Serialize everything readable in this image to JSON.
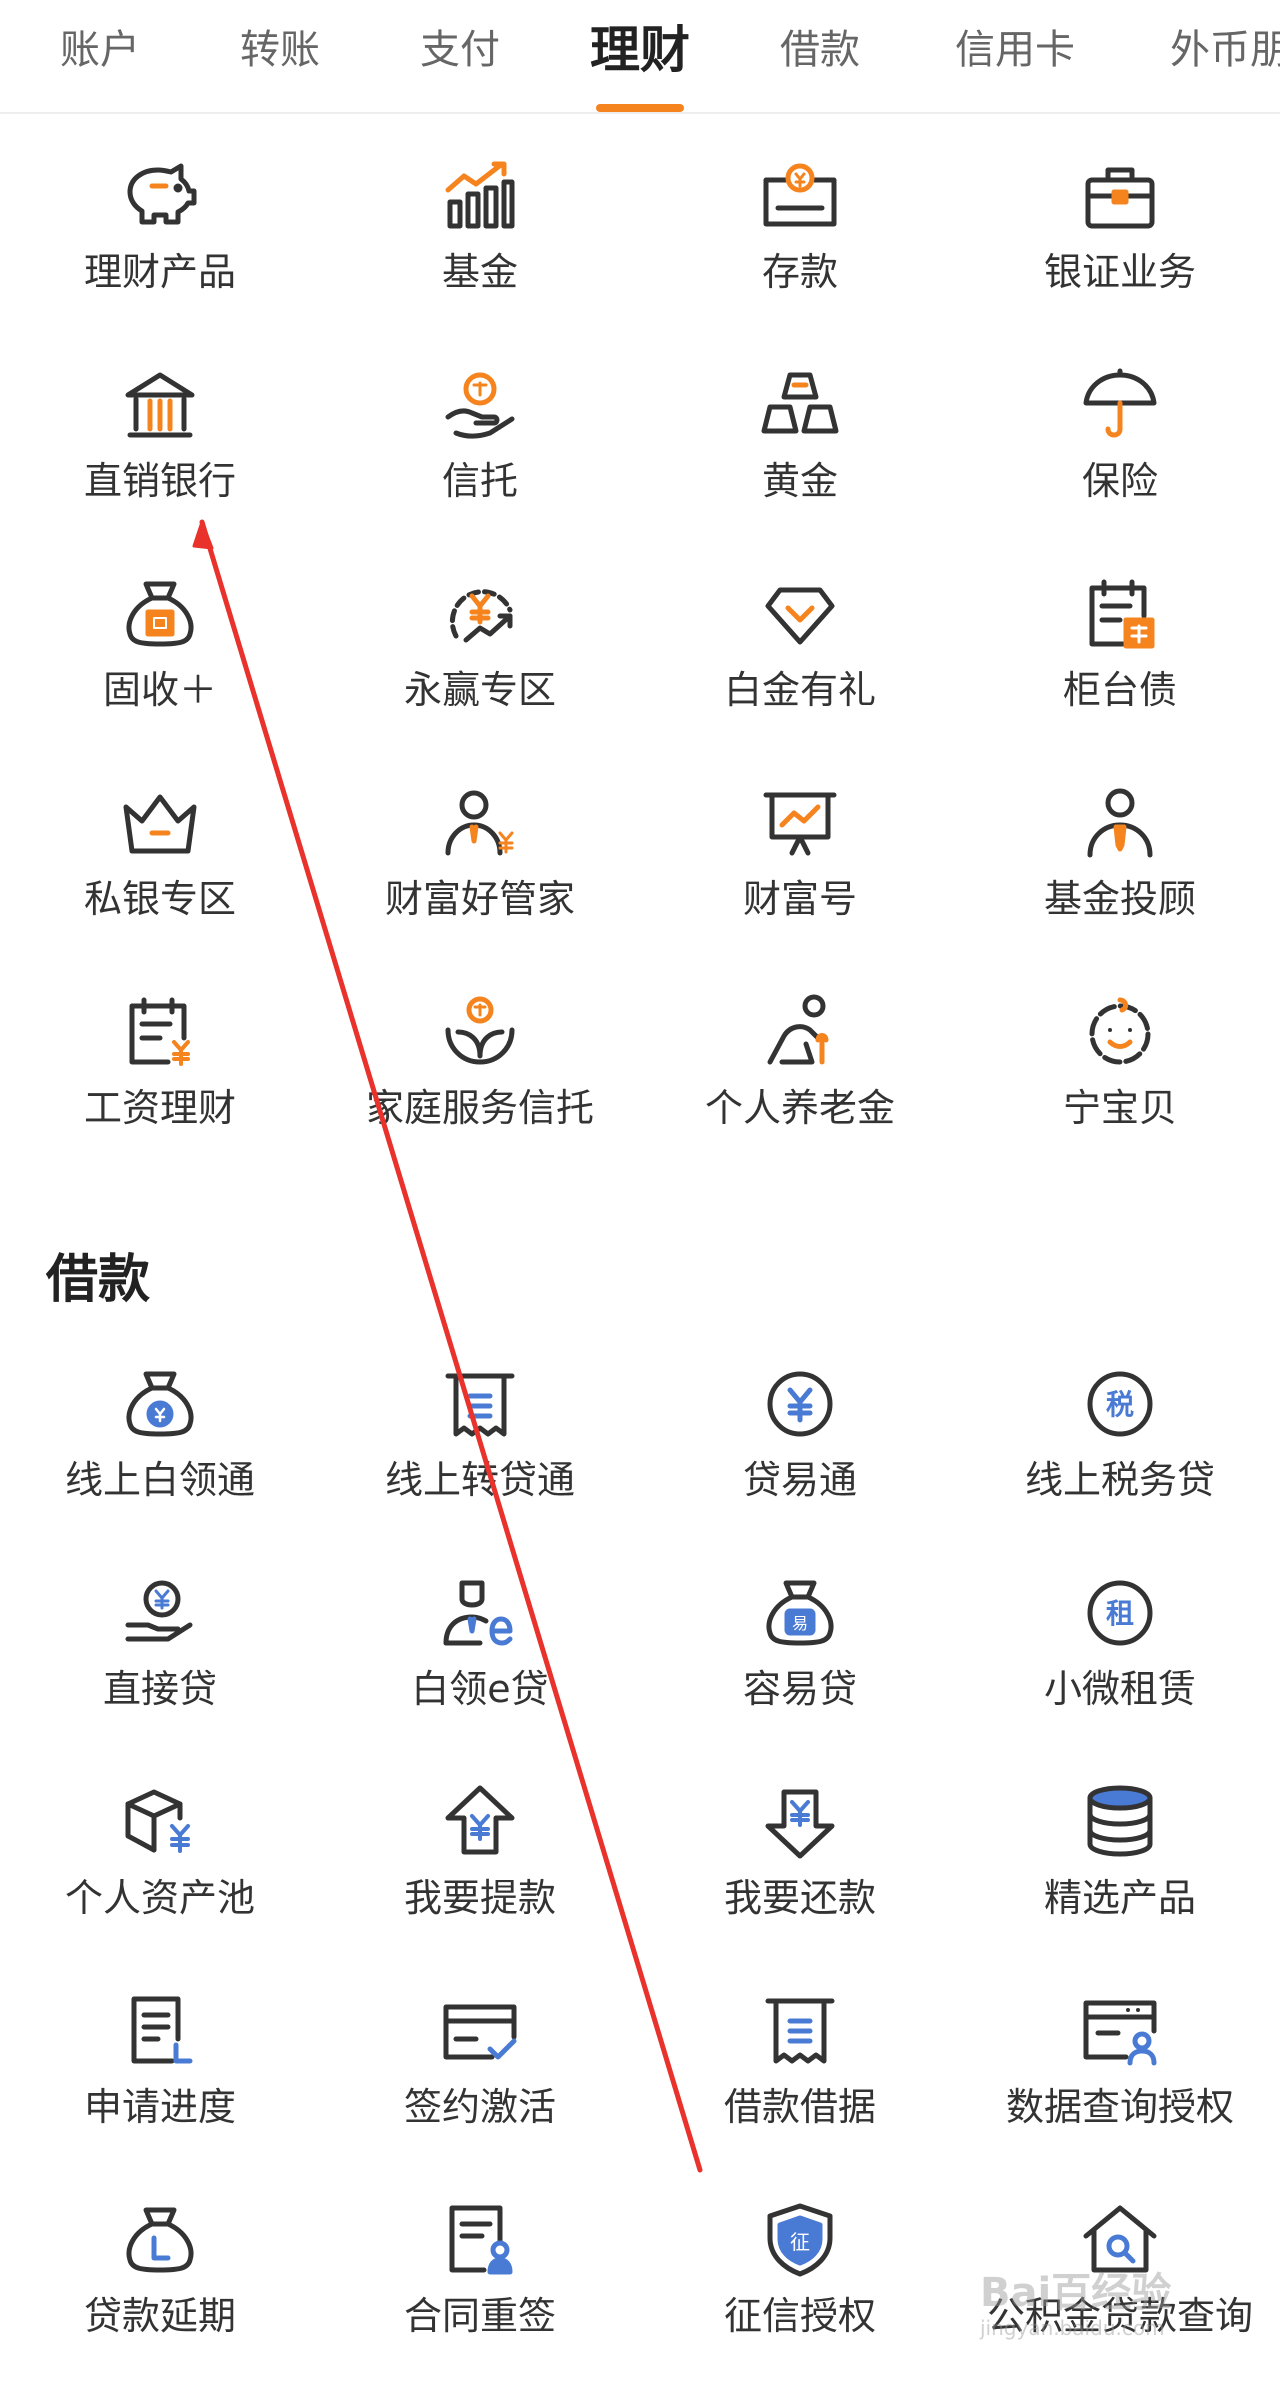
{
  "tabs": [
    {
      "label": "账户",
      "active": false
    },
    {
      "label": "转账",
      "active": false
    },
    {
      "label": "支付",
      "active": false
    },
    {
      "label": "理财",
      "active": true
    },
    {
      "label": "借款",
      "active": false
    },
    {
      "label": "信用卡",
      "active": false
    },
    {
      "label": "外币朋",
      "active": false
    }
  ],
  "colors": {
    "accent": "#f5841f",
    "dark": "#333333",
    "blue": "#4a7bd4"
  },
  "licai": {
    "items": [
      {
        "label": "理财产品",
        "icon": "piggy-bank-icon"
      },
      {
        "label": "基金",
        "icon": "bar-chart-icon"
      },
      {
        "label": "存款",
        "icon": "deposit-icon"
      },
      {
        "label": "银证业务",
        "icon": "briefcase-icon"
      },
      {
        "label": "直销银行",
        "icon": "bank-icon"
      },
      {
        "label": "信托",
        "icon": "trust-hand-icon"
      },
      {
        "label": "黄金",
        "icon": "gold-bars-icon"
      },
      {
        "label": "保险",
        "icon": "umbrella-icon"
      },
      {
        "label": "固收＋",
        "icon": "money-bag-icon"
      },
      {
        "label": "永赢专区",
        "icon": "yuan-circle-arrow-icon"
      },
      {
        "label": "白金有礼",
        "icon": "diamond-icon"
      },
      {
        "label": "柜台债",
        "icon": "bond-calendar-icon"
      },
      {
        "label": "私银专区",
        "icon": "crown-icon"
      },
      {
        "label": "财富好管家",
        "icon": "advisor-yuan-icon"
      },
      {
        "label": "财富号",
        "icon": "presentation-board-icon"
      },
      {
        "label": "基金投顾",
        "icon": "person-tie-icon"
      },
      {
        "label": "工资理财",
        "icon": "salary-calendar-icon"
      },
      {
        "label": "家庭服务信托",
        "icon": "family-trust-icon"
      },
      {
        "label": "个人养老金",
        "icon": "elderly-person-icon"
      },
      {
        "label": "宁宝贝",
        "icon": "baby-face-icon"
      }
    ]
  },
  "loan": {
    "title": "借款",
    "items": [
      {
        "label": "线上白领通",
        "icon": "yuan-bag-icon"
      },
      {
        "label": "线上转贷通",
        "icon": "receipt-icon"
      },
      {
        "label": "贷易通",
        "icon": "yuan-coin-icon"
      },
      {
        "label": "线上税务贷",
        "icon": "tax-coin-icon"
      },
      {
        "label": "直接贷",
        "icon": "coin-hand-icon"
      },
      {
        "label": "白领e贷",
        "icon": "person-e-icon"
      },
      {
        "label": "容易贷",
        "icon": "easy-bag-icon"
      },
      {
        "label": "小微租赁",
        "icon": "lease-coin-icon"
      },
      {
        "label": "个人资产池",
        "icon": "cube-yuan-icon"
      },
      {
        "label": "我要提款",
        "icon": "arrow-up-yuan-icon"
      },
      {
        "label": "我要还款",
        "icon": "arrow-down-yuan-icon"
      },
      {
        "label": "精选产品",
        "icon": "database-icon"
      },
      {
        "label": "申请进度",
        "icon": "document-progress-icon"
      },
      {
        "label": "签约激活",
        "icon": "card-check-icon"
      },
      {
        "label": "借款借据",
        "icon": "loan-receipt-icon"
      },
      {
        "label": "数据查询授权",
        "icon": "browser-user-icon"
      },
      {
        "label": "贷款延期",
        "icon": "bag-clock-icon"
      },
      {
        "label": "合同重签",
        "icon": "contract-stamp-icon"
      },
      {
        "label": "征信授权",
        "icon": "shield-credit-icon"
      },
      {
        "label": "公积金贷款查询",
        "icon": "house-search-icon"
      }
    ]
  },
  "watermark": {
    "main": "Bai百经验",
    "sub": "jingyan.baidu.com"
  }
}
